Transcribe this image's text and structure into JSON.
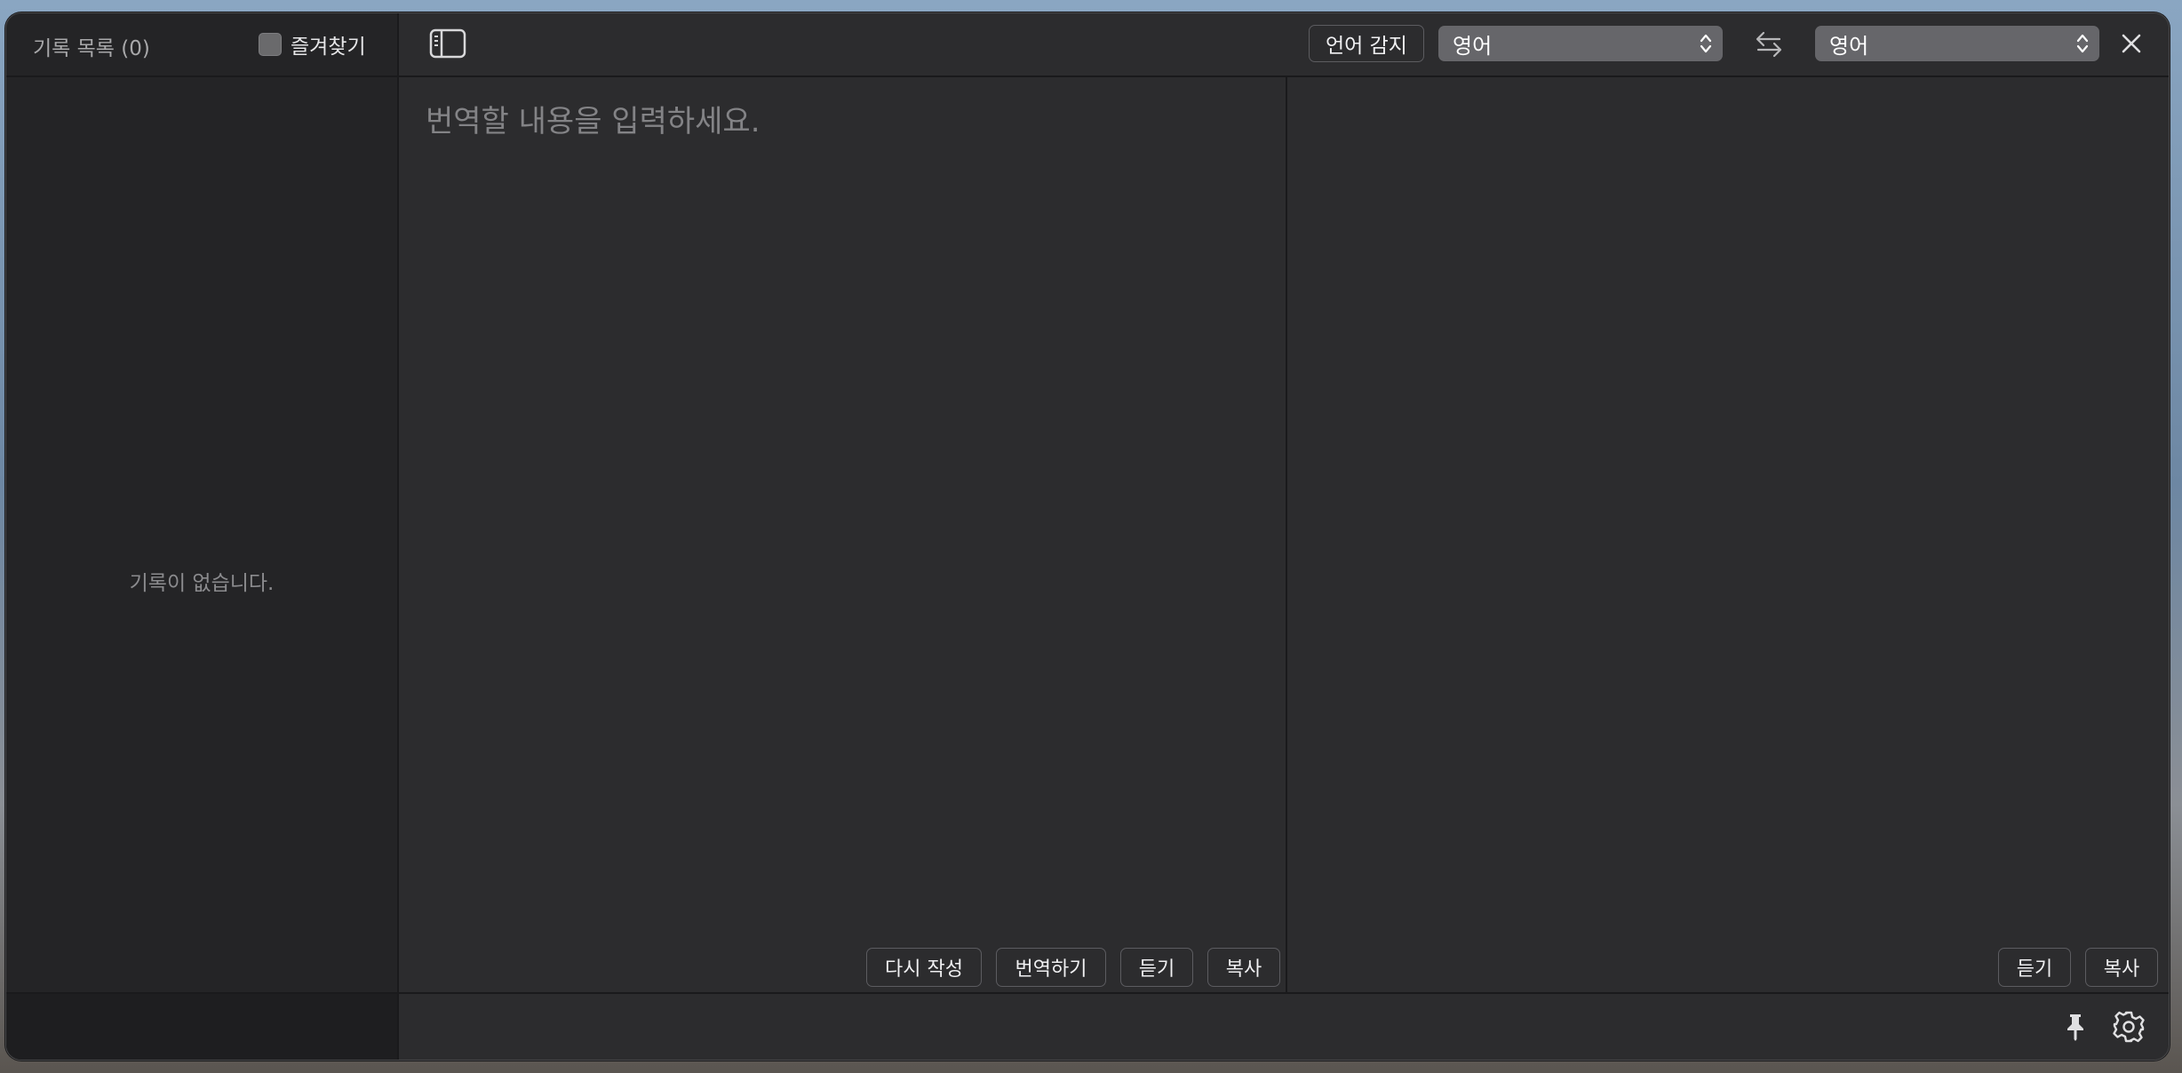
{
  "sidebar": {
    "title": "기록 목록 (0)",
    "favorites_label": "즐겨찾기",
    "favorites_checked": false,
    "empty_message": "기록이 없습니다."
  },
  "toolbar": {
    "detect_label": "언어 감지",
    "source_language": "영어",
    "target_language": "영어"
  },
  "source": {
    "placeholder": "번역할 내용을 입력하세요.",
    "value": "",
    "buttons": {
      "rewrite": "다시 작성",
      "translate": "번역하기",
      "listen": "듣기",
      "copy": "복사"
    }
  },
  "target": {
    "buttons": {
      "listen": "듣기",
      "copy": "복사"
    }
  },
  "icons": {
    "sidebar_toggle": "sidebar-toggle-icon",
    "swap": "swap-arrows-icon",
    "close": "close-icon",
    "pin": "pin-icon",
    "settings": "gear-icon"
  }
}
